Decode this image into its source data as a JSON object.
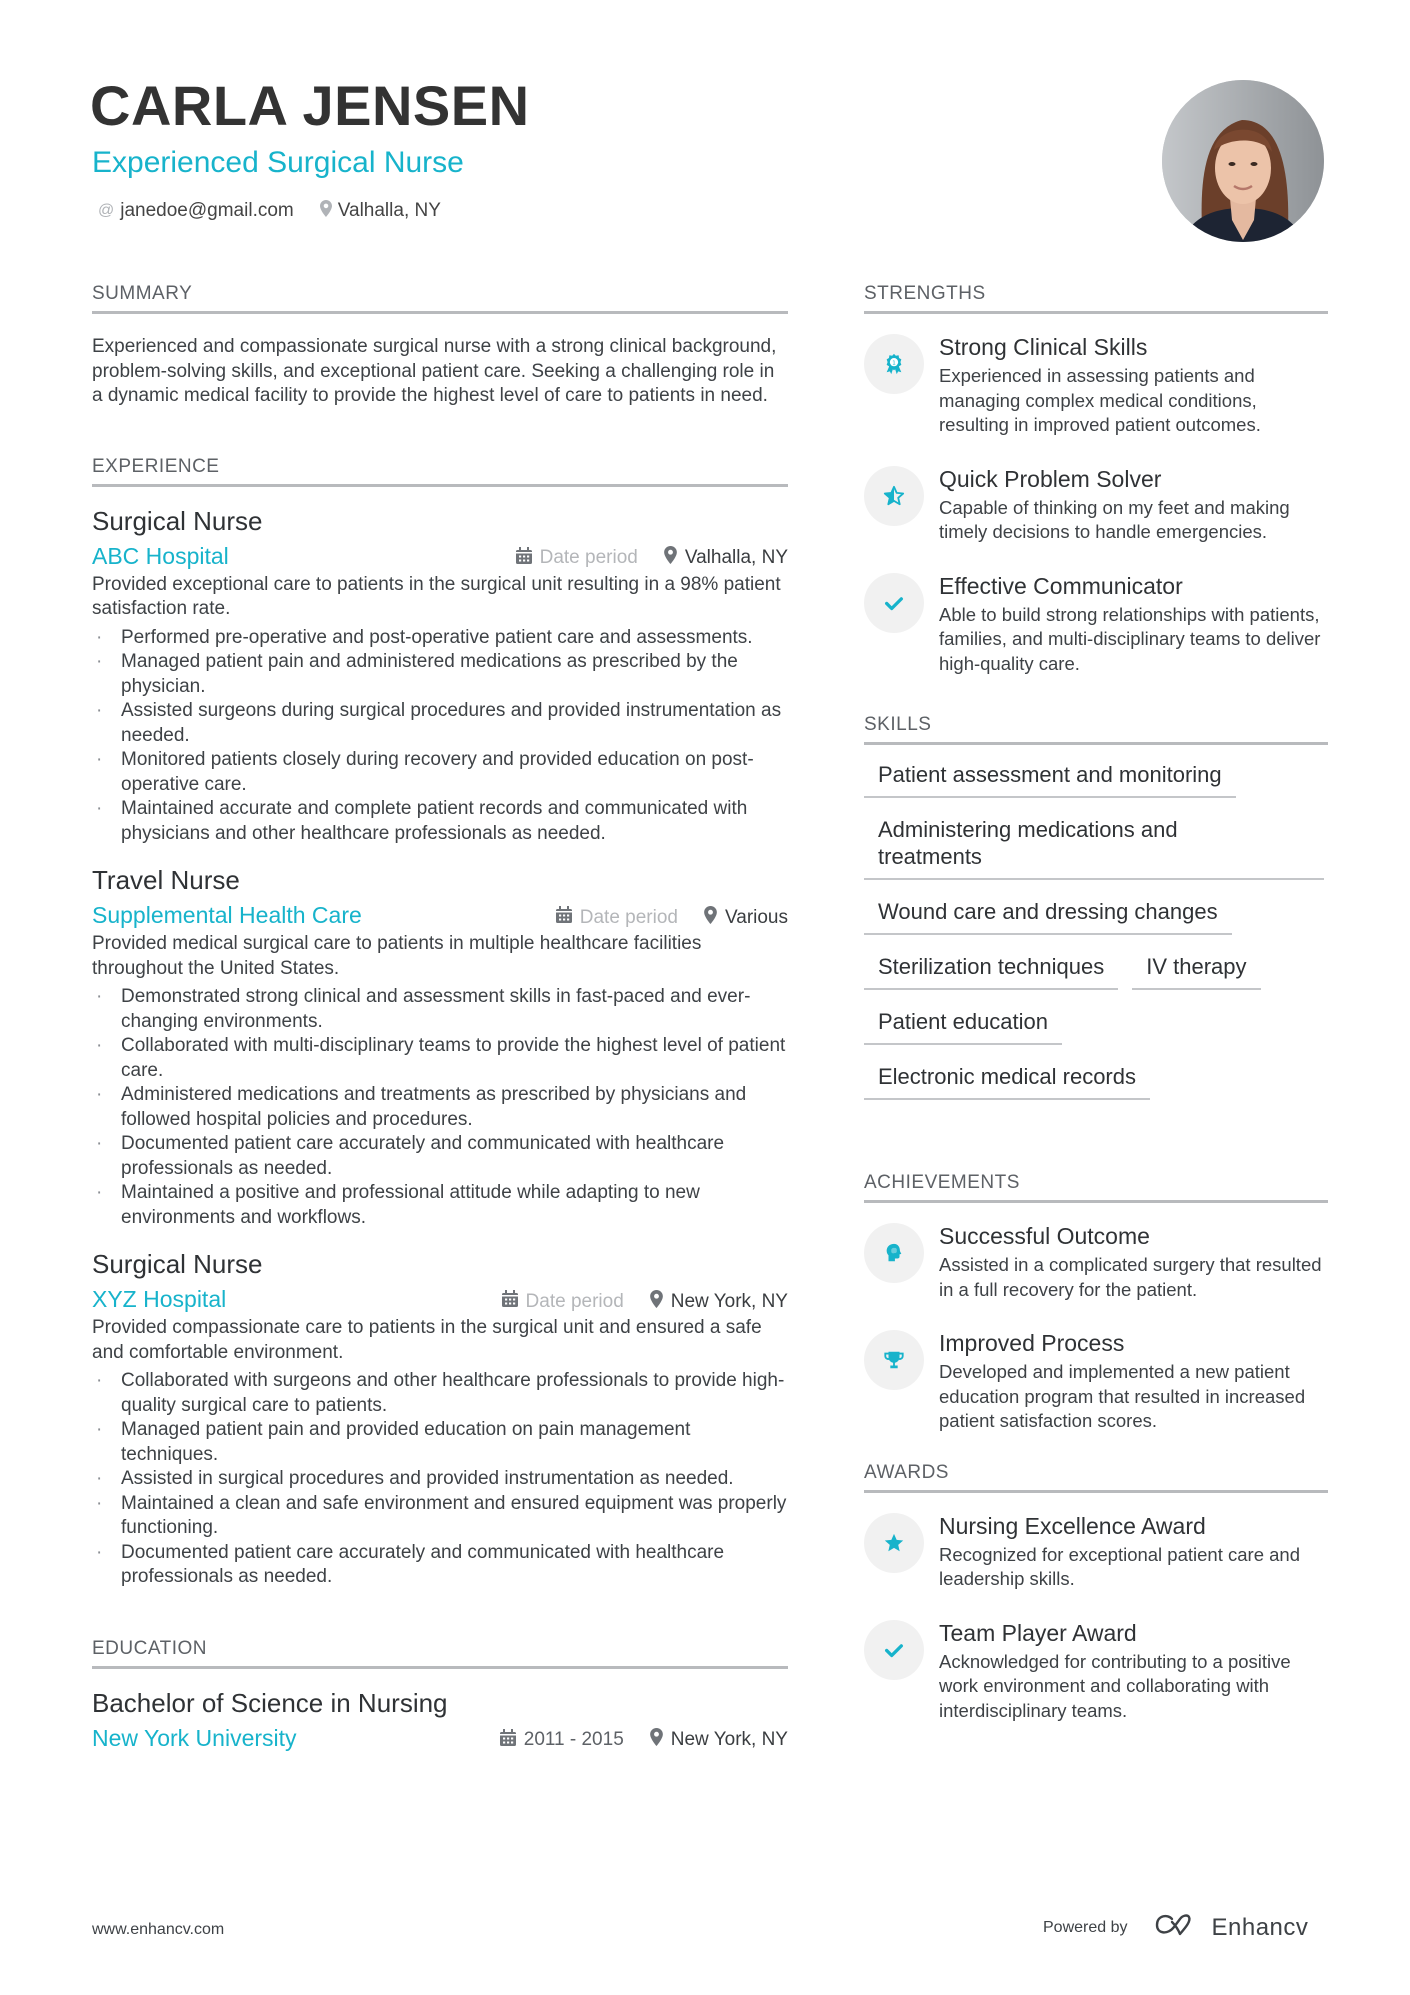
{
  "header": {
    "name": "CARLA JENSEN",
    "role": "Experienced Surgical Nurse",
    "email": "janedoe@gmail.com",
    "location": "Valhalla, NY",
    "photo_alt": "Profile photo"
  },
  "summary": {
    "title": "SUMMARY",
    "text": "Experienced and compassionate surgical nurse with a strong clinical background, problem-solving skills, and exceptional patient care. Seeking a challenging role in a dynamic medical facility to provide the highest level of care to patients in need."
  },
  "experience": {
    "title": "EXPERIENCE",
    "jobs": [
      {
        "title": "Surgical Nurse",
        "company": "ABC Hospital",
        "date": "Date period",
        "location": "Valhalla, NY",
        "description": "Provided exceptional care to patients in the surgical unit resulting in a 98% patient satisfaction rate.",
        "bullets": [
          "Performed pre-operative and post-operative patient care and assessments.",
          "Managed patient pain and administered medications as prescribed by the physician.",
          "Assisted surgeons during surgical procedures and provided instrumentation as needed.",
          "Monitored patients closely during recovery and provided education on post-operative care.",
          "Maintained accurate and complete patient records and communicated with physicians and other healthcare professionals as needed."
        ]
      },
      {
        "title": "Travel Nurse",
        "company": "Supplemental Health Care",
        "date": "Date period",
        "location": "Various",
        "description": "Provided medical surgical care to patients in multiple healthcare facilities throughout the United States.",
        "bullets": [
          "Demonstrated strong clinical and assessment skills in fast-paced and ever-changing environments.",
          "Collaborated with multi-disciplinary teams to provide the highest level of patient care.",
          "Administered medications and treatments as prescribed by physicians and followed hospital policies and procedures.",
          "Documented patient care accurately and communicated with healthcare professionals as needed.",
          "Maintained a positive and professional attitude while adapting to new environments and workflows."
        ]
      },
      {
        "title": "Surgical Nurse",
        "company": "XYZ Hospital",
        "date": "Date period",
        "location": "New York, NY",
        "description": "Provided compassionate care to patients in the surgical unit and ensured a safe and comfortable environment.",
        "bullets": [
          "Collaborated with surgeons and other healthcare professionals to provide high-quality surgical care to patients.",
          "Managed patient pain and provided education on pain management techniques.",
          "Assisted in surgical procedures and provided instrumentation as needed.",
          "Maintained a clean and safe environment and ensured equipment was properly functioning.",
          "Documented patient care accurately and communicated with healthcare professionals as needed."
        ]
      }
    ]
  },
  "education": {
    "title": "EDUCATION",
    "degree": "Bachelor of Science in Nursing",
    "school": "New York University",
    "dates": "2011 - 2015",
    "location": "New York, NY"
  },
  "strengths": {
    "title": "STRENGTHS",
    "items": [
      {
        "icon": "award-ribbon-icon",
        "title": "Strong Clinical Skills",
        "desc": "Experienced in assessing patients and managing complex medical conditions, resulting in improved patient outcomes."
      },
      {
        "icon": "half-star-icon",
        "title": "Quick Problem Solver",
        "desc": "Capable of thinking on my feet and making timely decisions to handle emergencies."
      },
      {
        "icon": "checkmark-icon",
        "title": "Effective Communicator",
        "desc": "Able to build strong relationships with patients, families, and multi-disciplinary teams to deliver high-quality care."
      }
    ]
  },
  "skills": {
    "title": "SKILLS",
    "items": [
      "Patient assessment and monitoring",
      "Administering medications and treatments",
      "Wound care and dressing changes",
      "Sterilization techniques",
      "IV therapy",
      "Patient education",
      "Electronic medical records"
    ]
  },
  "achievements": {
    "title": "ACHIEVEMENTS",
    "items": [
      {
        "icon": "head-brain-icon",
        "title": "Successful Outcome",
        "desc": "Assisted in a complicated surgery that resulted in a full recovery for the patient."
      },
      {
        "icon": "trophy-icon",
        "title": "Improved Process",
        "desc": "Developed and implemented a new patient education program that resulted in increased patient satisfaction scores."
      }
    ]
  },
  "awards": {
    "title": "AWARDS",
    "items": [
      {
        "icon": "star-icon",
        "title": "Nursing Excellence Award",
        "desc": "Recognized for exceptional patient care and leadership skills."
      },
      {
        "icon": "checkmark-icon",
        "title": "Team Player Award",
        "desc": "Acknowledged for contributing to a positive work environment and collaborating with interdisciplinary teams."
      }
    ]
  },
  "footer": {
    "website": "www.enhancv.com",
    "powered_by": "Powered by",
    "brand": "Enhancv"
  },
  "colors": {
    "accent": "#17b3cb",
    "text": "#3e4246",
    "heading": "#2f3235",
    "muted": "#b4b6b9",
    "rule": "#b8babd",
    "icon_bg": "#f1f1f1"
  }
}
